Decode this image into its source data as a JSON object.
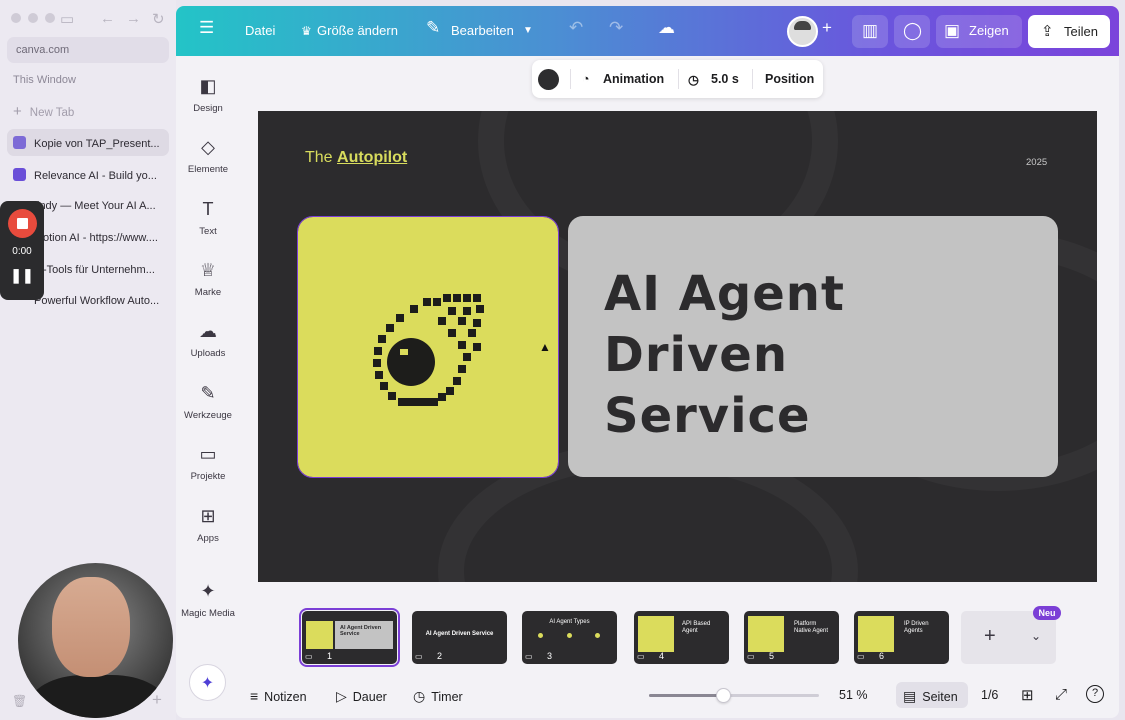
{
  "browser": {
    "url": "canva.com",
    "window_label": "This Window",
    "new_tab": "New Tab",
    "tabs": [
      {
        "title": "Kopie von TAP_Present...",
        "color": "#7d6bd6"
      },
      {
        "title": "Relevance AI - Build yo...",
        "color": "#6a4fd8"
      },
      {
        "title": "indy — Meet Your AI A...",
        "color": "#e96d7a"
      },
      {
        "title": "otion AI - https://www....",
        "color": "#222222"
      },
      {
        "title": "-Tools für Unternehm...",
        "color": "#3a7bd5"
      },
      {
        "title": "Powerful Workflow Auto...",
        "color": "#ff6a3d"
      }
    ],
    "recorder": {
      "time": "0:00"
    }
  },
  "topbar": {
    "menu_icon": "hamburger-icon",
    "file": "Datei",
    "resize": "Größe ändern",
    "edit": "Bearbeiten",
    "present": "Zeigen",
    "share": "Teilen"
  },
  "rail": {
    "items": [
      {
        "label": "Design",
        "icon": "design-icon"
      },
      {
        "label": "Elemente",
        "icon": "elements-icon"
      },
      {
        "label": "Text",
        "icon": "text-icon"
      },
      {
        "label": "Marke",
        "icon": "brand-icon"
      },
      {
        "label": "Uploads",
        "icon": "uploads-icon"
      },
      {
        "label": "Werkzeuge",
        "icon": "tools-icon"
      },
      {
        "label": "Projekte",
        "icon": "projects-icon"
      },
      {
        "label": "Apps",
        "icon": "apps-icon"
      },
      {
        "label": "Magic Media",
        "icon": "magic-media-icon"
      }
    ]
  },
  "float_toolbar": {
    "color": "#2d2d2f",
    "animation": "Animation",
    "duration": "5.0 s",
    "position": "Position"
  },
  "slide": {
    "brand_prefix": "The ",
    "brand_name": "Autopilot",
    "year": "2025",
    "title": "AI Agent\nDriven\nService",
    "accent": "#dbdc5c",
    "background": "#2c2b2d"
  },
  "thumbnails": [
    {
      "number": "1",
      "title": "AI Agent Driven Service"
    },
    {
      "number": "2",
      "title": "AI Agent Driven Service"
    },
    {
      "number": "3",
      "title": "AI Agent Types"
    },
    {
      "number": "4",
      "title": "API Based Agent"
    },
    {
      "number": "5",
      "title": "Platform Native Agent"
    },
    {
      "number": "6",
      "title": "IP Driven Agents"
    }
  ],
  "new_badge": "Neu",
  "bottombar": {
    "notes": "Notizen",
    "duration": "Dauer",
    "timer": "Timer",
    "zoom": "51 %",
    "zoom_value": 0.51,
    "pages": "Seiten",
    "page_count": "1/6"
  }
}
